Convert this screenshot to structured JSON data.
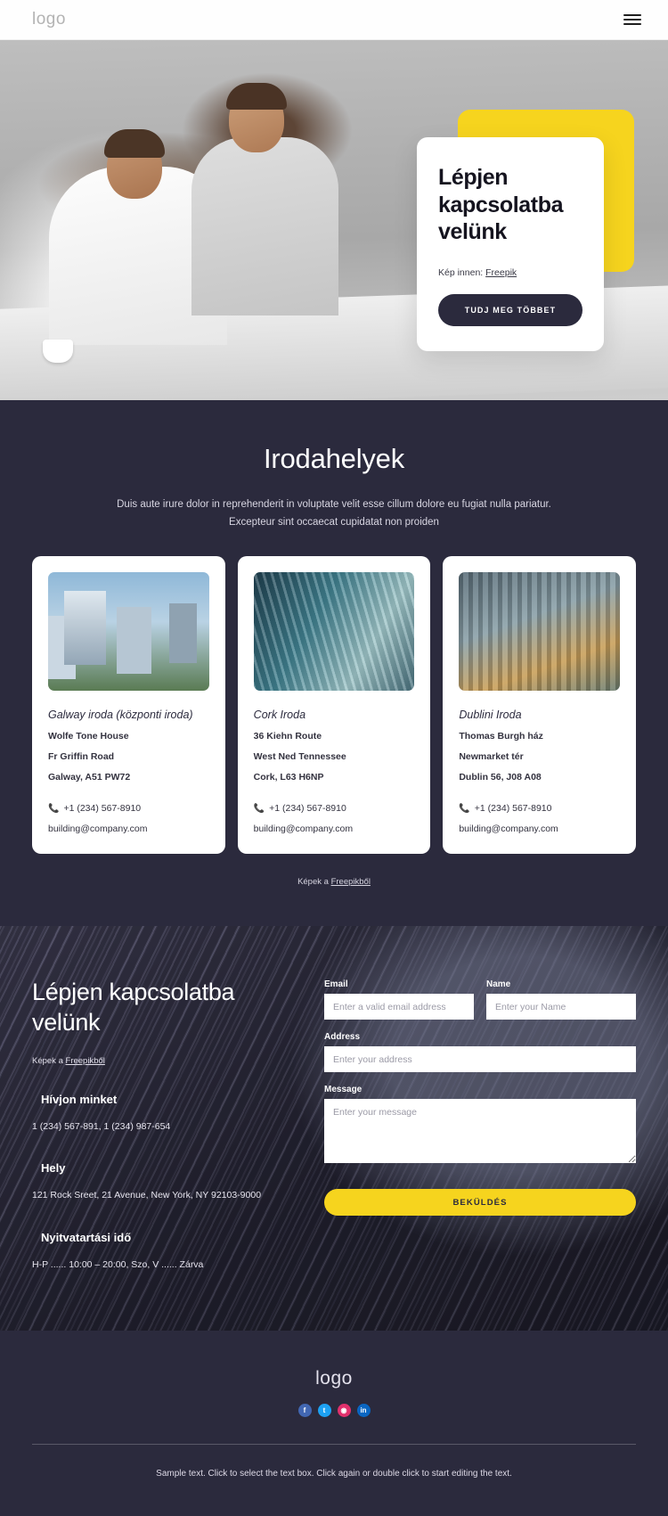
{
  "header": {
    "logo": "logo",
    "menu_icon": "hamburger-icon"
  },
  "hero": {
    "title": "Lépjen kapcsolatba velünk",
    "credit_prefix": "Kép innen:",
    "credit_link": "Freepik",
    "cta_label": "TUDJ MEG TÖBBET",
    "accent_color": "#f6d41e"
  },
  "offices": {
    "heading": "Irodahelyek",
    "subtitle_line1": "Duis aute irure dolor in reprehenderit in voluptate velit esse cillum dolore eu fugiat nulla pariatur.",
    "subtitle_line2": "Excepteur sint occaecat cupidatat non proiden",
    "credit_prefix": "Képek a",
    "credit_link": "Freepikből",
    "background_color": "#2b2a3d",
    "cards": [
      {
        "name": "Galway iroda (központi iroda)",
        "address_1": "Wolfe Tone House",
        "address_2": "Fr Griffin Road",
        "address_3": "Galway, A51 PW72",
        "phone": "+1 (234) 567-8910",
        "email": "building@company.com",
        "phone_icon": "phone-icon"
      },
      {
        "name": "Cork Iroda",
        "address_1": "36 Kiehn Route",
        "address_2": "West Ned Tennessee",
        "address_3": "Cork, L63 H6NP",
        "phone": "+1 (234) 567-8910",
        "email": "building@company.com",
        "phone_icon": "phone-icon"
      },
      {
        "name": "Dublini Iroda",
        "address_1": "Thomas Burgh ház",
        "address_2": "Newmarket tér",
        "address_3": "Dublin 56, J08 A08",
        "phone": "+1 (234) 567-8910",
        "email": "building@company.com",
        "phone_icon": "phone-icon"
      }
    ]
  },
  "contact": {
    "heading": "Lépjen kapcsolatba velünk",
    "credit_prefix": "Képek a",
    "credit_link": "Freepikből",
    "call_us_title": "Hívjon minket",
    "call_us_value": "1 (234) 567-891, 1 (234) 987-654",
    "location_title": "Hely",
    "location_value": "121 Rock Sreet, 21 Avenue, New York, NY 92103-9000",
    "hours_title": "Nyitvatartási idő",
    "hours_value": "H-P ...... 10:00 – 20:00, Szo, V ...... Zárva",
    "form": {
      "email_label": "Email",
      "email_placeholder": "Enter a valid email address",
      "email_value": "",
      "name_label": "Name",
      "name_placeholder": "Enter your Name",
      "name_value": "",
      "address_label": "Address",
      "address_placeholder": "Enter your address",
      "address_value": "",
      "message_label": "Message",
      "message_placeholder": "Enter your message",
      "message_value": "",
      "submit_label": "BEKÜLDÉS",
      "submit_color": "#f6d41e"
    }
  },
  "footer": {
    "logo": "logo",
    "socials": [
      {
        "name": "facebook-icon",
        "glyph": "f"
      },
      {
        "name": "twitter-icon",
        "glyph": "t"
      },
      {
        "name": "instagram-icon",
        "glyph": "◉"
      },
      {
        "name": "linkedin-icon",
        "glyph": "in"
      }
    ],
    "note_line1": "Sample text. Click to select the text box. Click again or double click to",
    "note_line2": "start editing the text."
  }
}
